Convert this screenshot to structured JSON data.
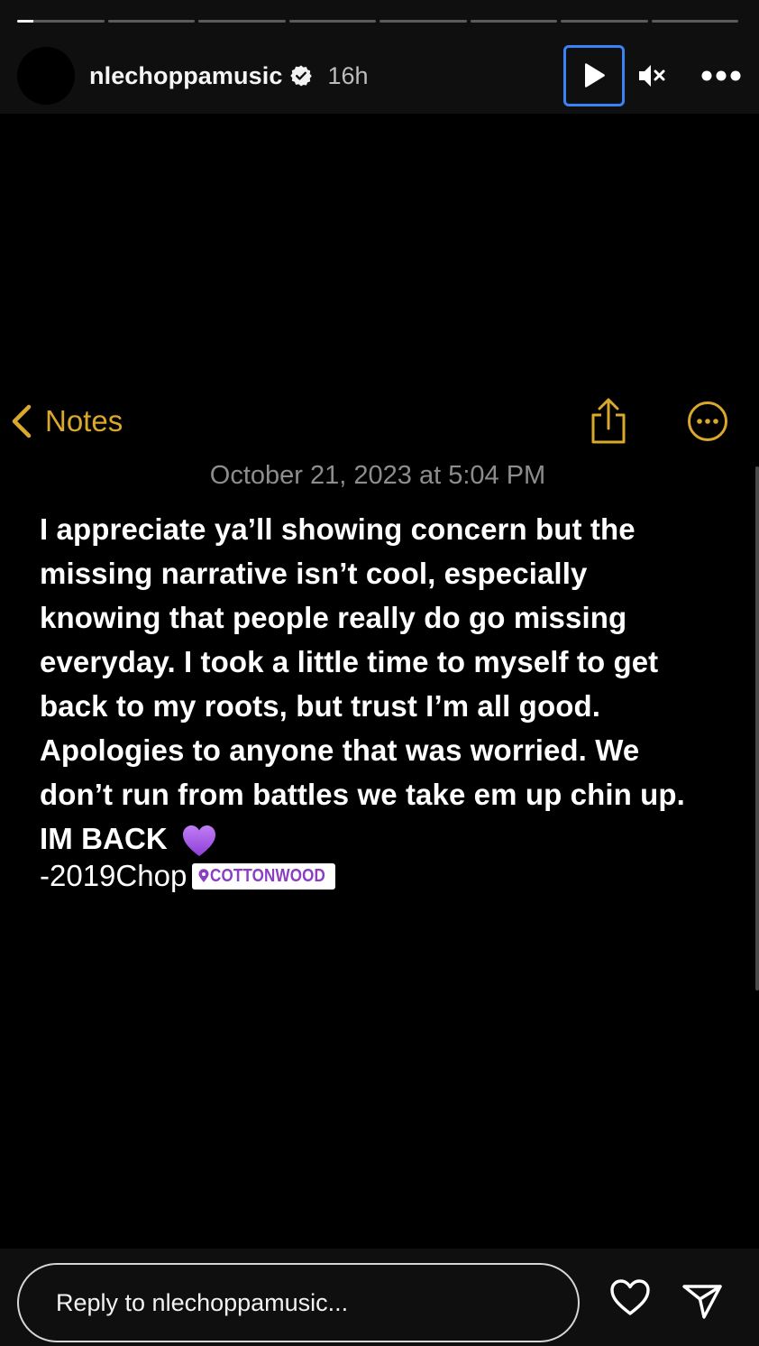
{
  "progress": {
    "segments": 8,
    "active_index": 0,
    "active_fraction": 0.19
  },
  "header": {
    "username": "nlechoppamusic",
    "time_ago": "16h",
    "verified_icon": "verified-badge-icon",
    "play_icon": "play-icon",
    "mute_icon": "speaker-muted-icon",
    "more_icon": "more-horizontal-icon"
  },
  "note": {
    "back_label": "Notes",
    "date": "October 21, 2023 at 5:04 PM",
    "lines": [
      "I appreciate ya’ll showing concern but the",
      "missing narrative isn’t cool, especially",
      "knowing that people really do go missing",
      "everyday. I took a little time to myself to get",
      "back to my roots, but trust I’m all good.",
      "Apologies to anyone that was worried. We",
      "don’t run from battles we take em up chin up.",
      "IM BACK"
    ],
    "signature": "-2019Chop",
    "location_sticker": "COTTONWOOD"
  },
  "footer": {
    "reply_placeholder": "Reply to nlechoppamusic...",
    "like_icon": "heart-outline-icon",
    "send_icon": "paper-plane-icon"
  },
  "colors": {
    "accent_notes": "#d9a82c",
    "focus_ring": "#3b82f6",
    "sticker_text": "#8a3ec2",
    "heart_emoji": "#a259e6"
  }
}
